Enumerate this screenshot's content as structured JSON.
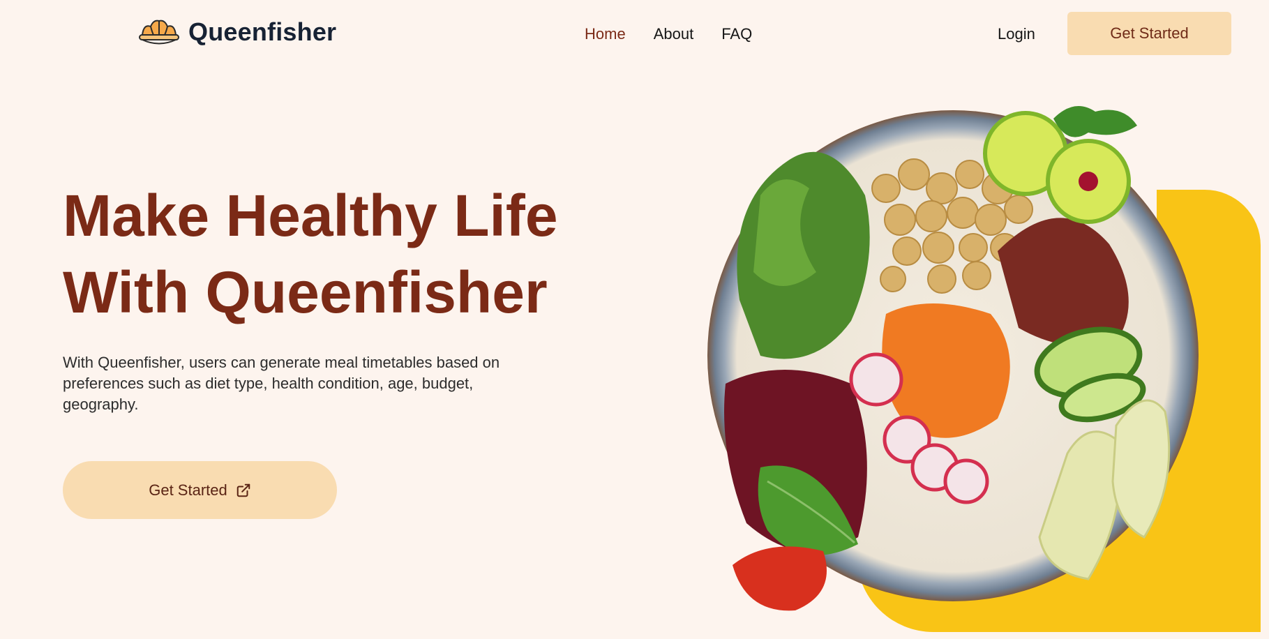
{
  "brand": {
    "name": "Queenfisher",
    "logo_icon": "crown-bowl-icon"
  },
  "nav": {
    "links": [
      {
        "label": "Home",
        "active": true
      },
      {
        "label": "About",
        "active": false
      },
      {
        "label": "FAQ",
        "active": false
      }
    ],
    "login_label": "Login",
    "cta_label": "Get Started"
  },
  "hero": {
    "title_line1": "Make Healthy Life",
    "title_line2": "With Queenfisher",
    "description": "With Queenfisher, users can generate meal timetables based on preferences such as diet type, health condition, age, budget, geography.",
    "cta_label": "Get Started",
    "cta_icon": "external-link-icon"
  },
  "colors": {
    "background": "#fdf4ee",
    "accent_peach": "#f9dcb1",
    "title_brown": "#7b2a16",
    "yellow": "#f9c416"
  }
}
